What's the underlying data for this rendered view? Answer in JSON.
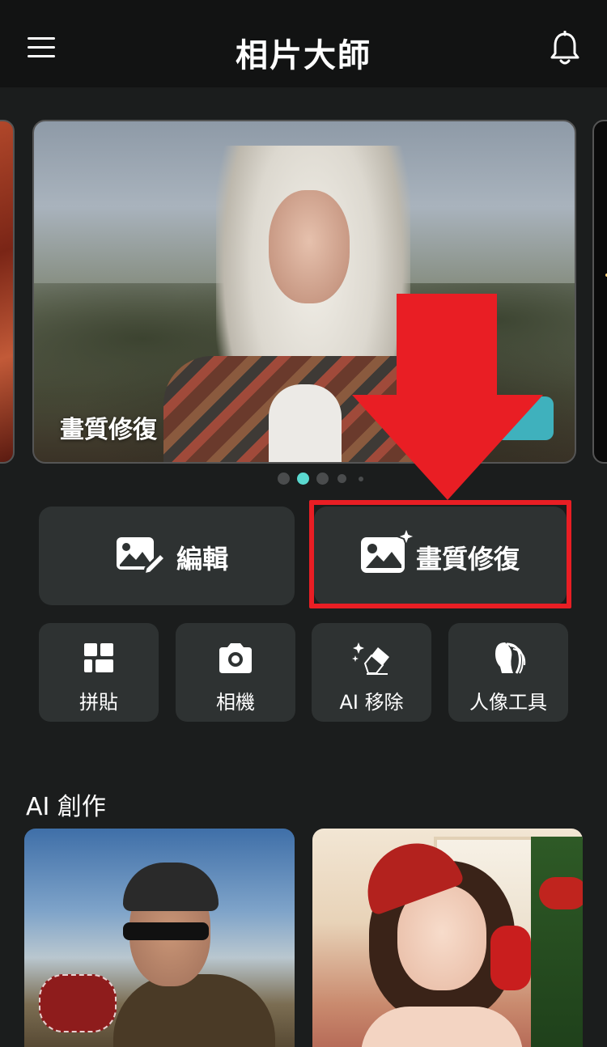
{
  "header": {
    "title": "相片大師",
    "menu_icon": "hamburger-menu-icon",
    "bell_icon": "bell-icon"
  },
  "carousel": {
    "active_card_label": "畫質修復",
    "page_count": 5,
    "active_index": 1
  },
  "actions": {
    "edit_label": "編輯",
    "enhance_label": "畫質修復"
  },
  "tools": [
    {
      "label": "拼貼",
      "icon": "collage-icon"
    },
    {
      "label": "相機",
      "icon": "camera-icon"
    },
    {
      "label": "AI 移除",
      "icon": "eraser-sparkle-icon"
    },
    {
      "label": "人像工具",
      "icon": "portrait-hair-icon"
    }
  ],
  "ai_section": {
    "title": "AI 創作"
  },
  "colors": {
    "background": "#1b1d1d",
    "card": "#2e3232",
    "accent": "#5ad9d0",
    "annotation_red": "#e91e24"
  }
}
